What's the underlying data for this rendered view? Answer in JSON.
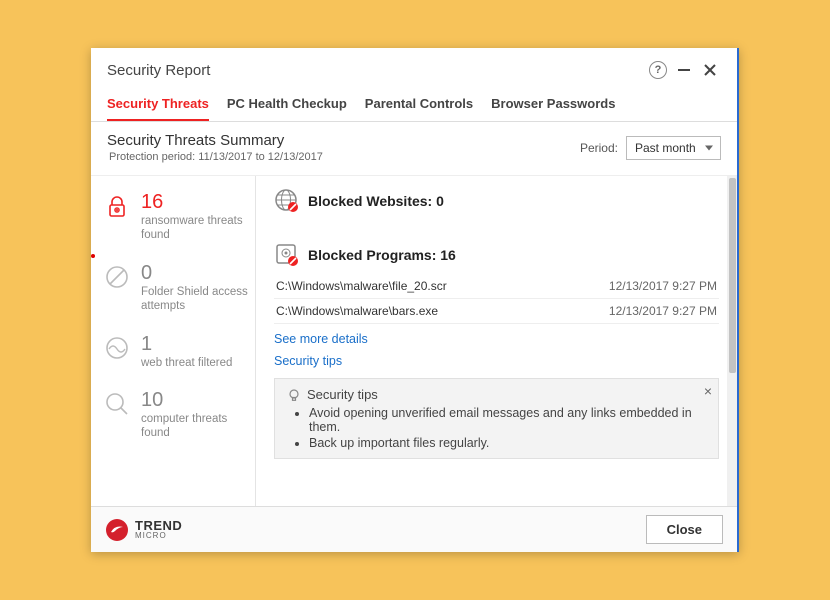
{
  "titlebar": {
    "title": "Security Report"
  },
  "tabs": [
    {
      "label": "Security Threats",
      "active": true
    },
    {
      "label": "PC Health Checkup",
      "active": false
    },
    {
      "label": "Parental Controls",
      "active": false
    },
    {
      "label": "Browser Passwords",
      "active": false
    }
  ],
  "summary": {
    "title": "Security Threats Summary",
    "subtitle": "Protection period: 11/13/2017 to 12/13/2017",
    "period_label": "Period:",
    "period_value": "Past month"
  },
  "sidebar_stats": [
    {
      "icon": "lock",
      "num": "16",
      "label": "ransomware threats found",
      "red_num": true
    },
    {
      "icon": "circle-slash",
      "num": "0",
      "label": "Folder Shield access attempts",
      "red_num": false
    },
    {
      "icon": "wave",
      "num": "1",
      "label": "web threat filtered",
      "red_num": false
    },
    {
      "icon": "magnify",
      "num": "10",
      "label": "computer threats found",
      "red_num": false
    }
  ],
  "blocked_websites": {
    "title_prefix": "Blocked Websites:",
    "count": "0"
  },
  "blocked_programs": {
    "title_prefix": "Blocked Programs:",
    "count": "16",
    "rows": [
      {
        "path": "C:\\Windows\\malware\\file_20.scr",
        "time": "12/13/2017 9:27 PM"
      },
      {
        "path": "C:\\Windows\\malware\\bars.exe",
        "time": "12/13/2017 9:27 PM"
      }
    ]
  },
  "links": {
    "see_more": "See more details",
    "security_tips": "Security tips"
  },
  "tips": {
    "title": "Security tips",
    "items": [
      "Avoid opening unverified email messages and any links embedded in them.",
      "Back up important files regularly."
    ]
  },
  "footer": {
    "brand": "TREND",
    "sub": "MICRO",
    "close": "Close"
  }
}
